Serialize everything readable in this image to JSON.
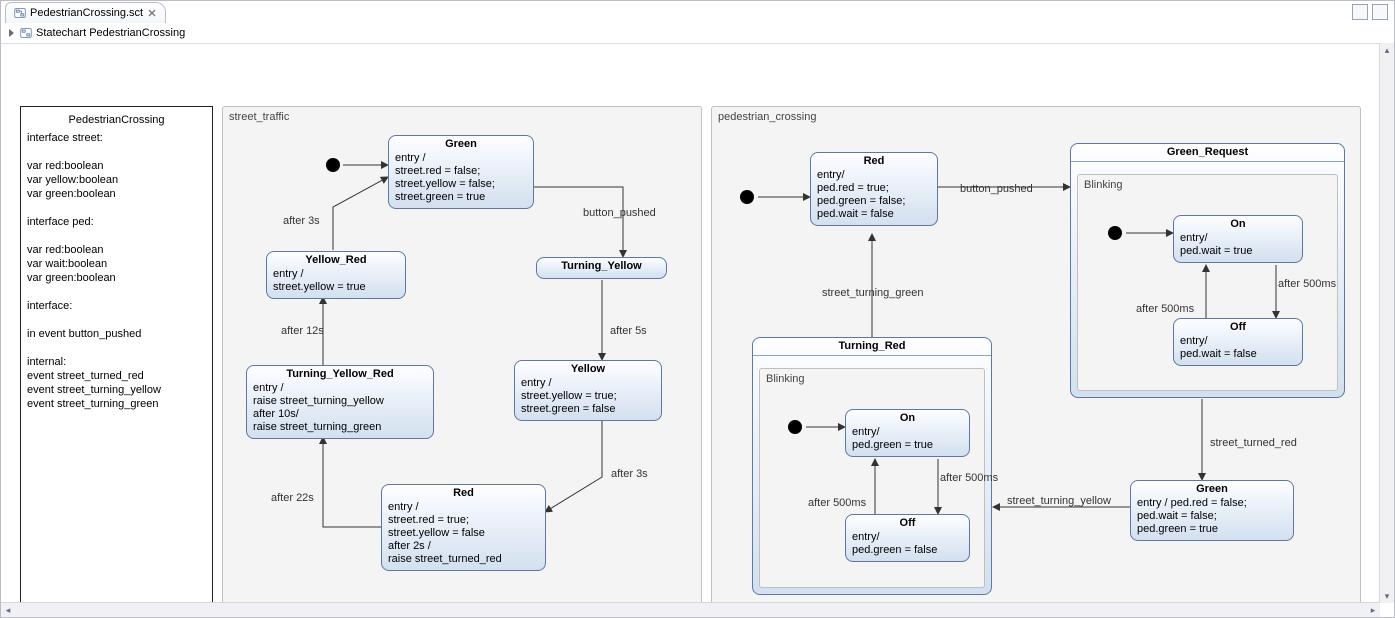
{
  "tab": {
    "title": "PedestrianCrossing.sct"
  },
  "breadcrumb": "Statechart PedestrianCrossing",
  "definitions": {
    "title": "PedestrianCrossing",
    "body": "interface street:\n\nvar red:boolean\nvar yellow:boolean\nvar green:boolean\n\ninterface ped:\n\nvar red:boolean\nvar wait:boolean\nvar green:boolean\n\ninterface:\n\nin event button_pushed\n\ninternal:\nevent street_turned_red\nevent street_turning_yellow\nevent street_turning_green"
  },
  "street": {
    "label": "street_traffic",
    "green": {
      "name": "Green",
      "body": "entry /\nstreet.red = false;\nstreet.yellow = false;\nstreet.green = true"
    },
    "yellow_red": {
      "name": "Yellow_Red",
      "body": "entry /\nstreet.yellow = true"
    },
    "turning_yellow": {
      "name": "Turning_Yellow",
      "body": ""
    },
    "turning_yellow_red": {
      "name": "Turning_Yellow_Red",
      "body": "entry /\nraise street_turning_yellow\nafter 10s/\nraise street_turning_green"
    },
    "yellow": {
      "name": "Yellow",
      "body": "entry /\nstreet.yellow = true;\nstreet.green = false"
    },
    "red": {
      "name": "Red",
      "body": "entry /\nstreet.red = true;\nstreet.yellow = false\nafter 2s /\nraise street_turned_red"
    },
    "t_button": "button_pushed",
    "t_after3s_a": "after 3s",
    "t_after5s": "after 5s",
    "t_after3s_b": "after 3s",
    "t_after12s": "after 12s",
    "t_after22s": "after 22s"
  },
  "ped": {
    "label": "pedestrian_crossing",
    "red": {
      "name": "Red",
      "body": "entry/\nped.red = true;\nped.green = false;\nped.wait = false"
    },
    "green_request": {
      "name": "Green_Request"
    },
    "gr_blinking": "Blinking",
    "gr_on": {
      "name": "On",
      "body": "entry/\nped.wait = true"
    },
    "gr_off": {
      "name": "Off",
      "body": "entry/\nped.wait = false"
    },
    "turning_red": {
      "name": "Turning_Red"
    },
    "tr_blinking": "Blinking",
    "tr_on": {
      "name": "On",
      "body": "entry/\nped.green = true"
    },
    "tr_off": {
      "name": "Off",
      "body": "entry/\nped.green = false"
    },
    "green": {
      "name": "Green",
      "body": "entry / ped.red = false;\nped.wait = false;\nped.green = true"
    },
    "t_button": "button_pushed",
    "t_turning_green": "street_turning_green",
    "t_turned_red": "street_turned_red",
    "t_turning_yellow": "street_turning_yellow",
    "t_after500_a": "after 500ms",
    "t_after500_b": "after 500ms",
    "t_after500_c": "after 500ms",
    "t_after500_d": "after 500ms"
  }
}
